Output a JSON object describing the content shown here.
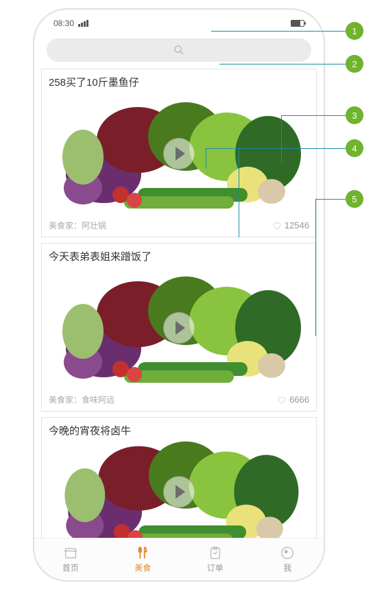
{
  "status": {
    "time": "08:30"
  },
  "search": {
    "placeholder": ""
  },
  "feed": [
    {
      "title": "258买了10斤墨鱼仔",
      "author_label": "美食家：阿壮锅",
      "likes": "12546"
    },
    {
      "title": "今天表弟表姐来蹭饭了",
      "author_label": "美食家：食味阿远",
      "likes": "6666"
    },
    {
      "title": "今晚的宵夜将卤牛",
      "author_label": "",
      "likes": ""
    }
  ],
  "tabs": [
    {
      "label": "首页"
    },
    {
      "label": "美食"
    },
    {
      "label": "订单"
    },
    {
      "label": "我"
    }
  ],
  "callouts": [
    "1",
    "2",
    "3",
    "4",
    "5"
  ]
}
